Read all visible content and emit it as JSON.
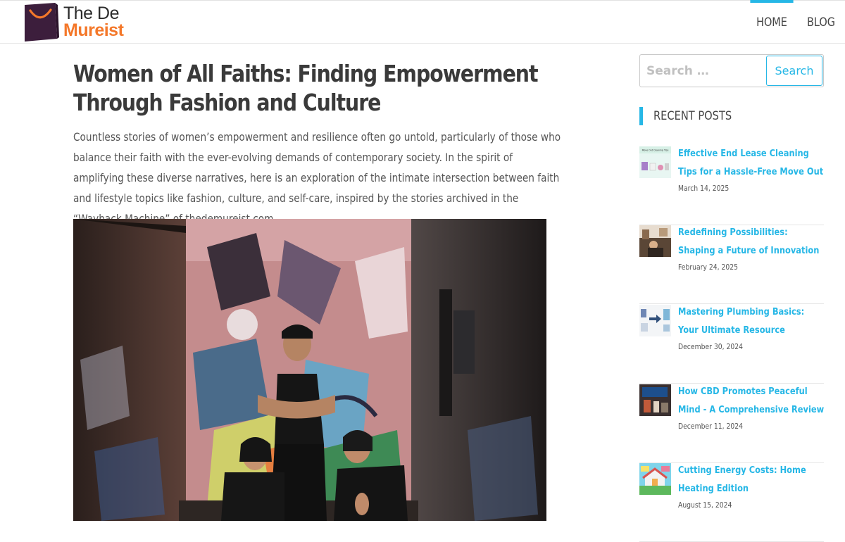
{
  "site": {
    "name_line1": "The De",
    "name_line2": "Mureist"
  },
  "nav": {
    "items": [
      {
        "label": "HOME"
      },
      {
        "label": "BLOG"
      }
    ]
  },
  "article": {
    "title": "Women of All Faiths: Finding Empowerment Through Fashion and Culture",
    "intro": "Countless stories of women’s empowerment and resilience often go untold, particularly of those who balance their faith with the ever-evolving demands of contemporary society. In the spirit of amplifying these diverse narratives, here is an exploration of the intimate intersection between faith and lifestyle topics like fashion, culture, and self-care, inspired by the stories archived in the “Wayback Machine” of thedemureist.com."
  },
  "search": {
    "placeholder": "Search …",
    "button_label": "Search"
  },
  "sidebar": {
    "recent_heading": "RECENT POSTS",
    "posts": [
      {
        "title": "Effective End Lease Cleaning Tips for a Hassle-Free Move Out",
        "date": "March 14, 2025",
        "thumb_caption": "Move Out Cleaning Tips"
      },
      {
        "title": "Redefining Possibilities: Shaping a Future of Innovation",
        "date": "February 24, 2025"
      },
      {
        "title": "Mastering Plumbing Basics: Your Ultimate Resource",
        "date": "December 30, 2024"
      },
      {
        "title": "How CBD Promotes Peaceful Mind - A Comprehensive Review",
        "date": "December 11, 2024"
      },
      {
        "title": "Cutting Energy Costs: Home Heating Edition",
        "date": "August 15, 2024"
      }
    ]
  },
  "colors": {
    "accent": "#26b7e6",
    "brand_orange": "#f4782a",
    "logo_purple": "#3c1e3c"
  }
}
